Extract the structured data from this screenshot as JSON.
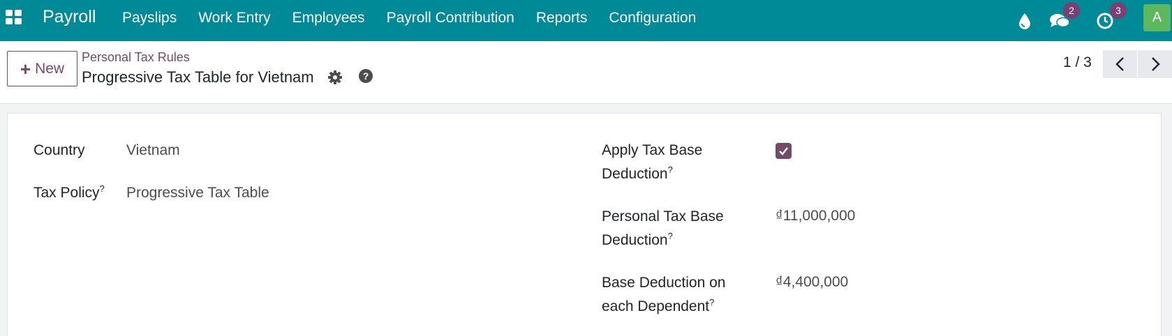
{
  "nav": {
    "app_name": "Payroll",
    "menu": [
      "Payslips",
      "Work Entry",
      "Employees",
      "Payroll Contribution",
      "Reports",
      "Configuration"
    ],
    "messages_count": "2",
    "activities_count": "3",
    "avatar_letter": "A",
    "icons": [
      "apps-icon",
      "drop-icon",
      "chat-icon",
      "clock-icon"
    ]
  },
  "control": {
    "new_label": "New",
    "breadcrumb": "Personal Tax Rules",
    "title": "Progressive Tax Table for Vietnam",
    "pager": "1 / 3"
  },
  "form": {
    "country_label": "Country",
    "country_value": "Vietnam",
    "tax_policy_label": "Tax Policy",
    "tax_policy_value": "Progressive Tax Table",
    "help_mark": "?",
    "apply_label_1": "Apply Tax Base",
    "apply_label_2": "Deduction",
    "apply_checked": true,
    "personal_label_1": "Personal Tax Base",
    "personal_label_2": "Deduction",
    "personal_value": "₫11,000,000",
    "dependent_label_1": "Base Deduction on",
    "dependent_label_2": "each Dependent",
    "dependent_value": "₫4,400,000"
  },
  "colors": {
    "navbar": "#008a97",
    "accent": "#714b67",
    "badge": "#7a3f73",
    "avatar": "#5cb85c"
  }
}
